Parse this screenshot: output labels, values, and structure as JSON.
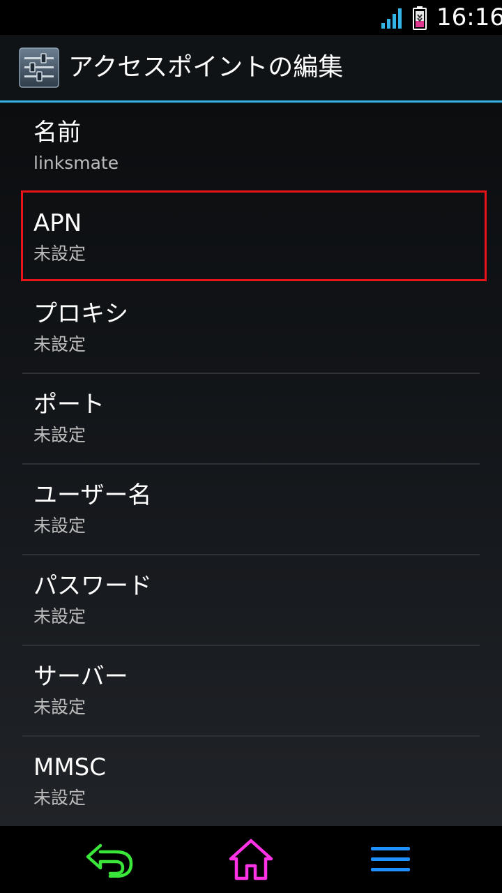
{
  "status_bar": {
    "time": "16:16",
    "signal_icon": "signal-bars-icon",
    "battery_icon": "battery-icon",
    "accent_color": "#33b5e5"
  },
  "action_bar": {
    "title": "アクセスポイントの編集",
    "icon": "settings-sliders-icon",
    "divider_color": "#33b5e5"
  },
  "preferences": [
    {
      "title": "名前",
      "summary": "linksmate"
    },
    {
      "title": "APN",
      "summary": "未設定"
    },
    {
      "title": "プロキシ",
      "summary": "未設定"
    },
    {
      "title": "ポート",
      "summary": "未設定"
    },
    {
      "title": "ユーザー名",
      "summary": "未設定"
    },
    {
      "title": "パスワード",
      "summary": "未設定"
    },
    {
      "title": "サーバー",
      "summary": "未設定"
    },
    {
      "title": "MMSC",
      "summary": "未設定"
    }
  ],
  "highlight_color": "#e8141a",
  "nav_bar": {
    "back_icon": "back-arrow-icon",
    "home_icon": "home-icon",
    "menu_icon": "menu-icon",
    "back_color": "#39e639",
    "home_color": "#ff33e6",
    "menu_color": "#1e90ff"
  }
}
